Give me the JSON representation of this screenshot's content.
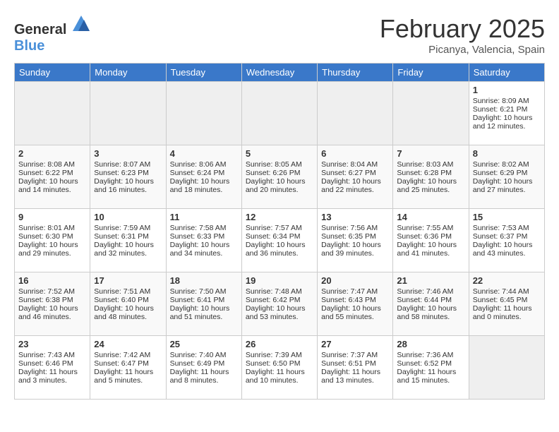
{
  "header": {
    "logo_general": "General",
    "logo_blue": "Blue",
    "month": "February 2025",
    "location": "Picanya, Valencia, Spain"
  },
  "days_of_week": [
    "Sunday",
    "Monday",
    "Tuesday",
    "Wednesday",
    "Thursday",
    "Friday",
    "Saturday"
  ],
  "weeks": [
    [
      {
        "day": "",
        "empty": true
      },
      {
        "day": "",
        "empty": true
      },
      {
        "day": "",
        "empty": true
      },
      {
        "day": "",
        "empty": true
      },
      {
        "day": "",
        "empty": true
      },
      {
        "day": "",
        "empty": true
      },
      {
        "day": "1",
        "sunrise": "Sunrise: 8:09 AM",
        "sunset": "Sunset: 6:21 PM",
        "daylight": "Daylight: 10 hours and 12 minutes."
      }
    ],
    [
      {
        "day": "2",
        "sunrise": "Sunrise: 8:08 AM",
        "sunset": "Sunset: 6:22 PM",
        "daylight": "Daylight: 10 hours and 14 minutes."
      },
      {
        "day": "3",
        "sunrise": "Sunrise: 8:07 AM",
        "sunset": "Sunset: 6:23 PM",
        "daylight": "Daylight: 10 hours and 16 minutes."
      },
      {
        "day": "4",
        "sunrise": "Sunrise: 8:06 AM",
        "sunset": "Sunset: 6:24 PM",
        "daylight": "Daylight: 10 hours and 18 minutes."
      },
      {
        "day": "5",
        "sunrise": "Sunrise: 8:05 AM",
        "sunset": "Sunset: 6:26 PM",
        "daylight": "Daylight: 10 hours and 20 minutes."
      },
      {
        "day": "6",
        "sunrise": "Sunrise: 8:04 AM",
        "sunset": "Sunset: 6:27 PM",
        "daylight": "Daylight: 10 hours and 22 minutes."
      },
      {
        "day": "7",
        "sunrise": "Sunrise: 8:03 AM",
        "sunset": "Sunset: 6:28 PM",
        "daylight": "Daylight: 10 hours and 25 minutes."
      },
      {
        "day": "8",
        "sunrise": "Sunrise: 8:02 AM",
        "sunset": "Sunset: 6:29 PM",
        "daylight": "Daylight: 10 hours and 27 minutes."
      }
    ],
    [
      {
        "day": "9",
        "sunrise": "Sunrise: 8:01 AM",
        "sunset": "Sunset: 6:30 PM",
        "daylight": "Daylight: 10 hours and 29 minutes."
      },
      {
        "day": "10",
        "sunrise": "Sunrise: 7:59 AM",
        "sunset": "Sunset: 6:31 PM",
        "daylight": "Daylight: 10 hours and 32 minutes."
      },
      {
        "day": "11",
        "sunrise": "Sunrise: 7:58 AM",
        "sunset": "Sunset: 6:33 PM",
        "daylight": "Daylight: 10 hours and 34 minutes."
      },
      {
        "day": "12",
        "sunrise": "Sunrise: 7:57 AM",
        "sunset": "Sunset: 6:34 PM",
        "daylight": "Daylight: 10 hours and 36 minutes."
      },
      {
        "day": "13",
        "sunrise": "Sunrise: 7:56 AM",
        "sunset": "Sunset: 6:35 PM",
        "daylight": "Daylight: 10 hours and 39 minutes."
      },
      {
        "day": "14",
        "sunrise": "Sunrise: 7:55 AM",
        "sunset": "Sunset: 6:36 PM",
        "daylight": "Daylight: 10 hours and 41 minutes."
      },
      {
        "day": "15",
        "sunrise": "Sunrise: 7:53 AM",
        "sunset": "Sunset: 6:37 PM",
        "daylight": "Daylight: 10 hours and 43 minutes."
      }
    ],
    [
      {
        "day": "16",
        "sunrise": "Sunrise: 7:52 AM",
        "sunset": "Sunset: 6:38 PM",
        "daylight": "Daylight: 10 hours and 46 minutes."
      },
      {
        "day": "17",
        "sunrise": "Sunrise: 7:51 AM",
        "sunset": "Sunset: 6:40 PM",
        "daylight": "Daylight: 10 hours and 48 minutes."
      },
      {
        "day": "18",
        "sunrise": "Sunrise: 7:50 AM",
        "sunset": "Sunset: 6:41 PM",
        "daylight": "Daylight: 10 hours and 51 minutes."
      },
      {
        "day": "19",
        "sunrise": "Sunrise: 7:48 AM",
        "sunset": "Sunset: 6:42 PM",
        "daylight": "Daylight: 10 hours and 53 minutes."
      },
      {
        "day": "20",
        "sunrise": "Sunrise: 7:47 AM",
        "sunset": "Sunset: 6:43 PM",
        "daylight": "Daylight: 10 hours and 55 minutes."
      },
      {
        "day": "21",
        "sunrise": "Sunrise: 7:46 AM",
        "sunset": "Sunset: 6:44 PM",
        "daylight": "Daylight: 10 hours and 58 minutes."
      },
      {
        "day": "22",
        "sunrise": "Sunrise: 7:44 AM",
        "sunset": "Sunset: 6:45 PM",
        "daylight": "Daylight: 11 hours and 0 minutes."
      }
    ],
    [
      {
        "day": "23",
        "sunrise": "Sunrise: 7:43 AM",
        "sunset": "Sunset: 6:46 PM",
        "daylight": "Daylight: 11 hours and 3 minutes."
      },
      {
        "day": "24",
        "sunrise": "Sunrise: 7:42 AM",
        "sunset": "Sunset: 6:47 PM",
        "daylight": "Daylight: 11 hours and 5 minutes."
      },
      {
        "day": "25",
        "sunrise": "Sunrise: 7:40 AM",
        "sunset": "Sunset: 6:49 PM",
        "daylight": "Daylight: 11 hours and 8 minutes."
      },
      {
        "day": "26",
        "sunrise": "Sunrise: 7:39 AM",
        "sunset": "Sunset: 6:50 PM",
        "daylight": "Daylight: 11 hours and 10 minutes."
      },
      {
        "day": "27",
        "sunrise": "Sunrise: 7:37 AM",
        "sunset": "Sunset: 6:51 PM",
        "daylight": "Daylight: 11 hours and 13 minutes."
      },
      {
        "day": "28",
        "sunrise": "Sunrise: 7:36 AM",
        "sunset": "Sunset: 6:52 PM",
        "daylight": "Daylight: 11 hours and 15 minutes."
      },
      {
        "day": "",
        "empty": true
      }
    ]
  ]
}
